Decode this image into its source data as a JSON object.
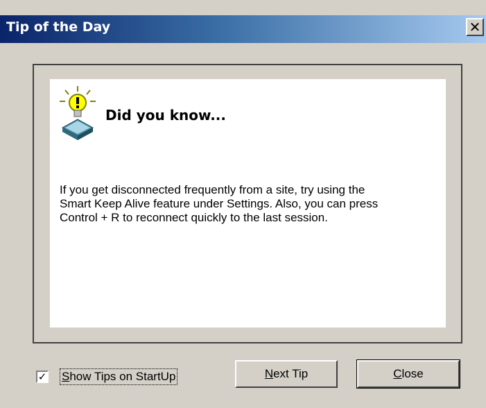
{
  "window": {
    "title": "Tip of the Day",
    "close_glyph": "✕"
  },
  "tip": {
    "heading": "Did you know...",
    "icon": "lightbulb-icon",
    "body": "If you get disconnected frequently from a site, try using the Smart Keep Alive feature under Settings. Also, you can press Control + R to reconnect quickly to the last session."
  },
  "footer": {
    "show_tips_label_first": "S",
    "show_tips_label_rest": "how Tips on StartUp",
    "show_tips_checked": true,
    "check_glyph": "✓",
    "next_tip_first": "N",
    "next_tip_rest": "ext Tip",
    "close_first": "C",
    "close_rest": "lose"
  },
  "colors": {
    "titlebar_start": "#0a246a",
    "titlebar_end": "#a6caf0",
    "face": "#d4d0c8"
  }
}
